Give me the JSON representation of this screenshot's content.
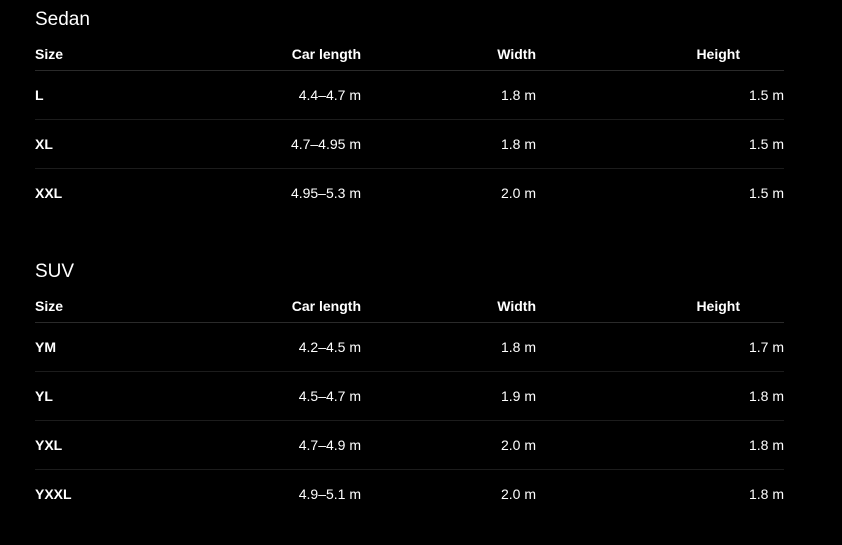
{
  "columns": {
    "size": "Size",
    "length": "Car length",
    "width": "Width",
    "height": "Height"
  },
  "sections": [
    {
      "title": "Sedan",
      "rows": [
        {
          "size": "L",
          "length": "4.4–4.7 m",
          "width": "1.8 m",
          "height": "1.5 m"
        },
        {
          "size": "XL",
          "length": "4.7–4.95 m",
          "width": "1.8 m",
          "height": "1.5 m"
        },
        {
          "size": "XXL",
          "length": "4.95–5.3 m",
          "width": "2.0 m",
          "height": "1.5 m"
        }
      ]
    },
    {
      "title": "SUV",
      "rows": [
        {
          "size": "YM",
          "length": "4.2–4.5 m",
          "width": "1.8 m",
          "height": "1.7 m"
        },
        {
          "size": "YL",
          "length": "4.5–4.7 m",
          "width": "1.9 m",
          "height": "1.8 m"
        },
        {
          "size": "YXL",
          "length": "4.7–4.9 m",
          "width": "2.0 m",
          "height": "1.8 m"
        },
        {
          "size": "YXXL",
          "length": "4.9–5.1 m",
          "width": "2.0 m",
          "height": "1.8 m"
        }
      ]
    }
  ]
}
